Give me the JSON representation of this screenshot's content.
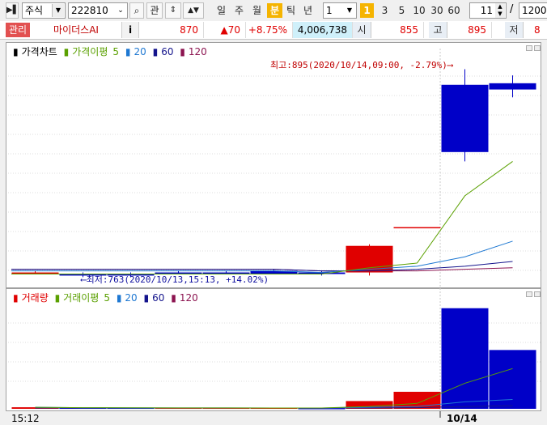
{
  "toolbar": {
    "market": "주식",
    "code": "222810",
    "btn_kwan": "관",
    "periods": [
      "일",
      "주",
      "월",
      "분",
      "틱",
      "년"
    ],
    "selected_period": "분",
    "period_count": "1",
    "interval_badge": "1",
    "intervals": [
      "3",
      "5",
      "10",
      "30",
      "60"
    ],
    "count_value": "11",
    "total_sep": "/",
    "total_value": "1200"
  },
  "quote": {
    "tag": "관리",
    "name": "마이더스AI",
    "info_btn": "i",
    "price": "870",
    "change": "▲70",
    "change_pct": "+8.75%",
    "volume": "4,006,738",
    "open_label": "시",
    "open": "855",
    "high_label": "고",
    "high": "895",
    "low_label": "저",
    "low": "8"
  },
  "colors": {
    "up": "#e00000",
    "down": "#0000c8",
    "ma5": "#5aa000",
    "ma20": "#1e78d2",
    "ma60": "#14148c",
    "ma120": "#8c1450"
  },
  "legend_price": {
    "title": "가격차트",
    "ma": "가격이평",
    "p5": "5",
    "p20": "20",
    "p60": "60",
    "p120": "120"
  },
  "legend_volume": {
    "title": "거래량",
    "ma": "거래이평",
    "p5": "5",
    "p20": "20",
    "p60": "60",
    "p120": "120"
  },
  "annotations": {
    "high": "최고:895(2020/10/14,09:00, -2.79%)⟶",
    "low": "⟵최저:763(2020/10/13,15:13, +14.02%)"
  },
  "x_axis": {
    "start_label": "15:12",
    "date_label": "10/14"
  },
  "chart_data": [
    {
      "type": "candlestick",
      "title": "가격차트",
      "ylim": [
        757,
        903
      ],
      "candles": [
        {
          "o": 765,
          "h": 766,
          "l": 764,
          "c": 765
        },
        {
          "o": 764,
          "h": 765,
          "l": 762,
          "c": 763
        },
        {
          "o": 764,
          "h": 765,
          "l": 762,
          "c": 763
        },
        {
          "o": 765,
          "h": 766,
          "l": 764,
          "c": 764
        },
        {
          "o": 765,
          "h": 766,
          "l": 764,
          "c": 764
        },
        {
          "o": 766,
          "h": 767,
          "l": 764,
          "c": 764
        },
        {
          "o": 765,
          "h": 766,
          "l": 763,
          "c": 764
        },
        {
          "o": 765,
          "h": 783,
          "l": 763,
          "c": 782
        },
        {
          "o": 794,
          "h": 794,
          "l": 794,
          "c": 794
        },
        {
          "o": 885,
          "h": 895,
          "l": 836,
          "c": 842
        },
        {
          "o": 886,
          "h": 891,
          "l": 877,
          "c": 882
        }
      ],
      "ma5": [
        null,
        null,
        null,
        null,
        764,
        764,
        764,
        768,
        771,
        814,
        836
      ],
      "ma20": [
        null,
        null,
        null,
        null,
        766,
        766,
        765,
        767,
        769,
        775,
        785
      ],
      "ma60": [
        null,
        null,
        null,
        null,
        767,
        767,
        766,
        766,
        767,
        769,
        772
      ],
      "ma120": [
        null,
        null,
        null,
        null,
        767,
        767,
        766,
        766,
        766,
        767,
        768
      ]
    },
    {
      "type": "bar",
      "title": "거래량",
      "values": [
        2,
        1,
        1,
        1,
        1,
        1,
        0.5,
        10,
        22,
        130,
        76
      ],
      "up": [
        true,
        false,
        false,
        true,
        true,
        true,
        false,
        true,
        true,
        false,
        false
      ],
      "ylim": [
        0,
        136
      ],
      "ma5": [
        2,
        1.5,
        1.3,
        1.2,
        1.2,
        1,
        1,
        3,
        7,
        33,
        52
      ],
      "ma20": [
        2,
        1.5,
        1.3,
        1.2,
        1.2,
        1.1,
        1,
        2,
        3,
        9,
        12
      ],
      "ma60": [
        1,
        1,
        1,
        1,
        1,
        1,
        1,
        1,
        1.5,
        3,
        4
      ]
    }
  ]
}
